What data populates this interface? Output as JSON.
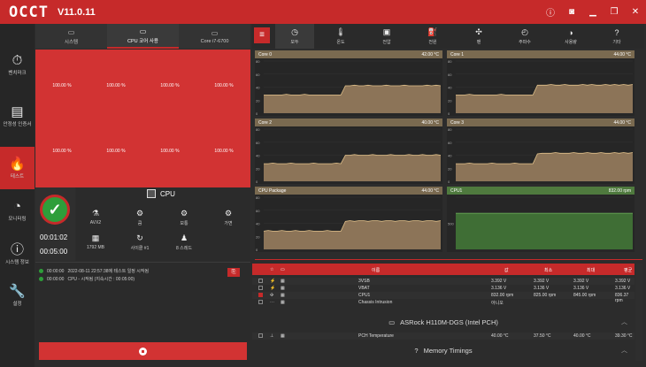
{
  "app": {
    "logo": "OCCT",
    "version": "V11.0.11"
  },
  "window_controls": [
    "i",
    "camera",
    "minimize",
    "restore",
    "close"
  ],
  "leftnav": [
    {
      "icon": "stopwatch-icon",
      "glyph": "⏱",
      "label": "벤치마크"
    },
    {
      "icon": "stability-icon",
      "glyph": "▤",
      "label": "안정성 인증서"
    },
    {
      "icon": "flame-icon",
      "glyph": "🔥",
      "label": "테스트"
    },
    {
      "icon": "monitor-icon",
      "glyph": "◔",
      "label": "모니터링"
    },
    {
      "icon": "info-icon",
      "glyph": "ⓘ",
      "label": "시스템 정보"
    },
    {
      "icon": "wrench-icon",
      "glyph": "🔧",
      "label": "설정"
    }
  ],
  "lefttabs": [
    {
      "label": "시스템",
      "glyph": "▭"
    },
    {
      "label": "CPU 코어 사용",
      "glyph": "▭"
    },
    {
      "label": "Core i7-6700",
      "glyph": "▭"
    }
  ],
  "cores": [
    "100.00 %",
    "100.00 %",
    "100.00 %",
    "100.00 %",
    "100.00 %",
    "100.00 %",
    "100.00 %",
    "100.00 %"
  ],
  "status": {
    "elapsed": "00:01:02",
    "duration": "00:05:00"
  },
  "cpu": {
    "title": "CPU",
    "options": [
      {
        "icon": "flask-icon",
        "glyph": "⚗",
        "label": "AVX2"
      },
      {
        "icon": "gears-icon",
        "glyph": "⚙",
        "label": "큼"
      },
      {
        "icon": "gears-icon",
        "glyph": "⚙",
        "label": "보통"
      },
      {
        "icon": "gears-icon",
        "glyph": "⚙",
        "label": "가변"
      },
      {
        "icon": "chip-icon",
        "glyph": "▦",
        "label": "1792 MB"
      },
      {
        "icon": "cycle-icon",
        "glyph": "↻",
        "label": "사이클 #1"
      },
      {
        "icon": "threads-icon",
        "glyph": "♟",
        "label": "8 스레드"
      }
    ]
  },
  "logs": [
    {
      "time": "00:00:00",
      "text": "2022-08-11 22:57:38에 테스트 일정 시작됨"
    },
    {
      "time": "00:00:00",
      "text": "CPU - 시작됨 (지속시간 : 00:05:00)"
    }
  ],
  "copy_glyph": "⎘",
  "menu_glyph": "≡",
  "righttabs": [
    {
      "icon": "clock-icon",
      "glyph": "◷",
      "label": "모두"
    },
    {
      "icon": "temperature-icon",
      "glyph": "🌡",
      "label": "온도"
    },
    {
      "icon": "voltage-icon",
      "glyph": "▣",
      "label": "전압"
    },
    {
      "icon": "power-icon",
      "glyph": "⛽",
      "label": "전원"
    },
    {
      "icon": "fan-icon",
      "glyph": "✣",
      "label": "팬"
    },
    {
      "icon": "frequency-icon",
      "glyph": "◴",
      "label": "주파수"
    },
    {
      "icon": "usage-icon",
      "glyph": "◑",
      "label": "사용량"
    },
    {
      "icon": "other-icon",
      "glyph": "?",
      "label": "기타"
    }
  ],
  "chart_data": [
    {
      "type": "area",
      "title": "Core 0",
      "readout": "42.00 °C",
      "yticks": [
        "80",
        "60",
        "40",
        "20",
        "0"
      ],
      "values": [
        28,
        28,
        28,
        28,
        28,
        29,
        28,
        28,
        28,
        29,
        28,
        28,
        28,
        28,
        28,
        28,
        28,
        28,
        42,
        42,
        43,
        42,
        42,
        43,
        42,
        42,
        42,
        43,
        42,
        42,
        42,
        43,
        42,
        42,
        42,
        42,
        43,
        42,
        43,
        42
      ]
    },
    {
      "type": "area",
      "title": "Core 1",
      "readout": "44.00 °C",
      "yticks": [
        "80",
        "60",
        "40",
        "20",
        "0"
      ],
      "values": [
        28,
        28,
        28,
        29,
        28,
        28,
        28,
        28,
        28,
        28,
        29,
        28,
        28,
        28,
        28,
        28,
        28,
        28,
        43,
        43,
        43,
        44,
        43,
        43,
        44,
        43,
        43,
        43,
        44,
        43,
        44,
        43,
        43,
        44,
        43,
        44,
        43,
        44,
        43,
        44
      ]
    },
    {
      "type": "area",
      "title": "Core 2",
      "readout": "40.00 °C",
      "yticks": [
        "80",
        "60",
        "40",
        "20",
        "0"
      ],
      "values": [
        27,
        27,
        28,
        27,
        27,
        27,
        28,
        27,
        27,
        27,
        27,
        28,
        27,
        27,
        27,
        27,
        28,
        27,
        40,
        40,
        41,
        40,
        40,
        40,
        41,
        40,
        40,
        40,
        41,
        40,
        40,
        40,
        41,
        40,
        40,
        41,
        40,
        40,
        41,
        40
      ]
    },
    {
      "type": "area",
      "title": "Core 3",
      "readout": "44.00 °C",
      "yticks": [
        "80",
        "60",
        "40",
        "20",
        "0"
      ],
      "values": [
        27,
        27,
        27,
        28,
        27,
        27,
        27,
        27,
        28,
        27,
        27,
        27,
        27,
        28,
        27,
        27,
        27,
        27,
        42,
        43,
        43,
        43,
        44,
        43,
        43,
        43,
        44,
        43,
        43,
        44,
        43,
        43,
        44,
        43,
        43,
        44,
        43,
        44,
        43,
        44
      ]
    },
    {
      "type": "area",
      "title": "CPU Package",
      "readout": "44.00 °C",
      "yticks": [
        "80",
        "60",
        "40",
        "20",
        "0"
      ],
      "values": [
        28,
        29,
        28,
        28,
        29,
        28,
        28,
        29,
        28,
        28,
        29,
        28,
        28,
        28,
        29,
        28,
        28,
        28,
        43,
        44,
        43,
        44,
        44,
        43,
        44,
        44,
        43,
        44,
        44,
        43,
        44,
        44,
        43,
        44,
        44,
        43,
        44,
        44,
        43,
        44
      ]
    },
    {
      "type": "area",
      "title": "CPU1",
      "readout": "832.00 rpm",
      "yticks": [
        "",
        "500",
        ""
      ],
      "ylim": [
        0,
        1200
      ],
      "values": [
        832,
        832,
        832,
        832,
        832,
        832,
        832,
        832,
        832,
        832,
        832,
        832,
        832,
        832,
        832,
        832,
        832,
        832,
        832,
        832,
        832,
        832,
        832,
        832,
        832,
        832,
        832,
        832,
        832,
        832,
        832,
        832,
        832,
        832,
        832,
        832,
        832,
        832,
        832,
        832
      ]
    }
  ],
  "sensor_table": {
    "headers": [
      "이름",
      "값",
      "최소",
      "최대",
      "평균"
    ],
    "header_icons": [
      "☆",
      "▭"
    ],
    "rows": [
      {
        "icon": "voltage-icon",
        "glyph": "⚡",
        "name": "3VSB",
        "value": "3.392 V",
        "min": "3.392 V",
        "max": "3.392 V",
        "avg": "3.392 V",
        "checked": false
      },
      {
        "icon": "voltage-icon",
        "glyph": "⚡",
        "name": "VBAT",
        "value": "3.136 V",
        "min": "3.136 V",
        "max": "3.136 V",
        "avg": "3.136 V",
        "checked": false
      },
      {
        "icon": "fan-icon",
        "glyph": "✣",
        "name": "CPU1",
        "value": "832.00 rpm",
        "min": "825.00 rpm",
        "max": "845.00 rpm",
        "avg": "836.37 rpm",
        "checked": true
      },
      {
        "icon": "other-icon",
        "glyph": "⋯",
        "name": "Chassis Intrusion",
        "value": "아니오",
        "min": "",
        "max": "",
        "avg": "",
        "checked": false
      }
    ],
    "board": {
      "name": "ASRock H110M-DGS (Intel PCH)",
      "glyph": "▭"
    },
    "board_rows": [
      {
        "icon": "temperature-icon",
        "glyph": "⊥",
        "name": "PCH Temperature",
        "value": "40.00 °C",
        "min": "37.50 °C",
        "max": "40.00 °C",
        "avg": "39.30 °C",
        "checked": false
      }
    ],
    "memory": {
      "name": "Memory Timings",
      "glyph": "?"
    }
  },
  "colors": {
    "accent": "#c62a2a",
    "area": "#8c7458",
    "area_line": "#e0c08a",
    "fan_area": "#3f6e35",
    "ok": "#2e9e3a"
  }
}
